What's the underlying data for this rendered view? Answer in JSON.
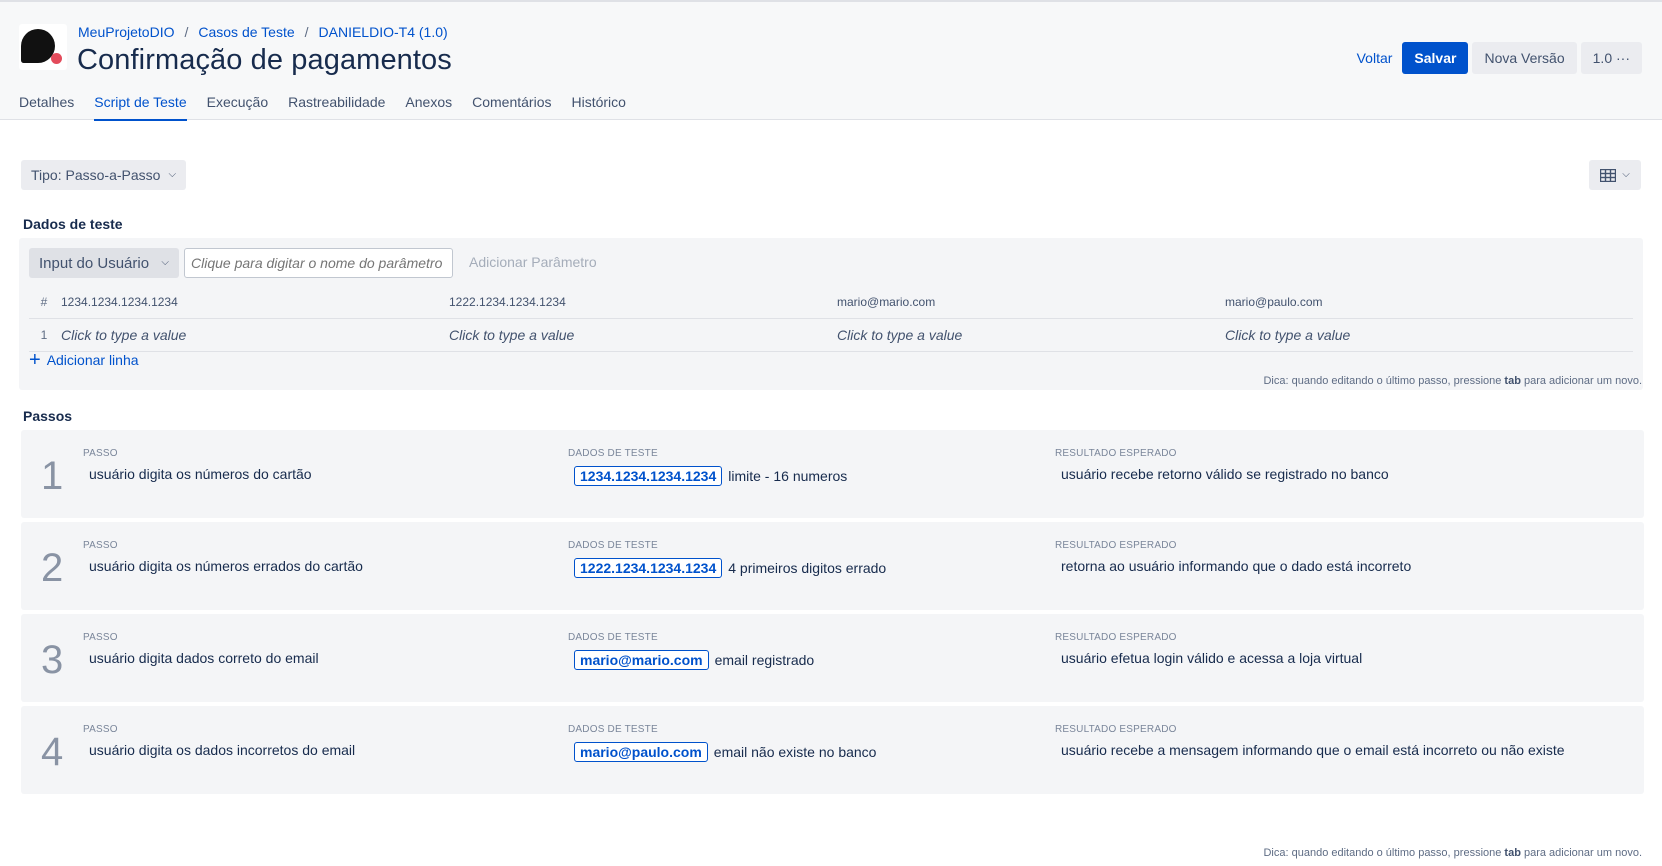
{
  "header": {
    "breadcrumb": [
      "MeuProjetoDIO",
      "Casos de Teste",
      "DANIELDIO-T4 (1.0)"
    ],
    "title": "Confirmação de pagamentos",
    "actions": {
      "back": "Voltar",
      "save": "Salvar",
      "new_version": "Nova Versão",
      "version": "1.0",
      "more": "···"
    }
  },
  "tabs": [
    {
      "label": "Detalhes",
      "active": false
    },
    {
      "label": "Script de Teste",
      "active": true
    },
    {
      "label": "Execução",
      "active": false
    },
    {
      "label": "Rastreabilidade",
      "active": false
    },
    {
      "label": "Anexos",
      "active": false
    },
    {
      "label": "Comentários",
      "active": false
    },
    {
      "label": "Histórico",
      "active": false
    }
  ],
  "toolbar": {
    "type_select": "Tipo: Passo-a-Passo",
    "view_icon": "table-icon"
  },
  "test_data": {
    "title": "Dados de teste",
    "input_type": "Input do Usuário",
    "param_placeholder": "Clique para digitar o nome do parâmetro",
    "add_param": "Adicionar Parâmetro",
    "header_num": "#",
    "columns": [
      "1234.1234.1234.1234",
      "1222.1234.1234.1234",
      "mario@mario.com",
      "mario@paulo.com"
    ],
    "rows": [
      {
        "num": "1",
        "values": [
          "Click to type a value",
          "Click to type a value",
          "Click to type a value",
          "Click to type a value"
        ]
      }
    ],
    "add_line": "Adicionar linha"
  },
  "hint": {
    "prefix": "Dica: quando editando o último passo, pressione",
    "key": "tab",
    "suffix": "para adicionar um novo."
  },
  "steps_section": {
    "title": "Passos",
    "more": "···",
    "labels": {
      "step": "PASSO",
      "data": "DADOS DE TESTE",
      "expected": "RESULTADO ESPERADO"
    },
    "steps": [
      {
        "index": "1",
        "step": "usuário digita os números do cartão",
        "chip": "1234.1234.1234.1234",
        "data": "limite - 16 numeros",
        "expected": "usuário recebe retorno válido se registrado no banco"
      },
      {
        "index": "2",
        "step": "usuário digita os números errados do cartão",
        "chip": "1222.1234.1234.1234",
        "data": "4 primeiros digitos errado",
        "expected": "retorna ao usuário informando que o dado está incorreto"
      },
      {
        "index": "3",
        "step": "usuário digita dados correto do email",
        "chip": "mario@mario.com",
        "data": "email registrado",
        "expected": "usuário efetua login válido e acessa a loja virtual"
      },
      {
        "index": "4",
        "step": "usuário digita os dados incorretos do email",
        "chip": "mario@paulo.com",
        "data": "email não existe no banco",
        "expected": "usuário recebe a mensagem informando que o email está incorreto ou não existe"
      }
    ]
  },
  "colors": {
    "accent": "#0052cc",
    "panel": "#f4f5f7",
    "text": "#172b4d"
  }
}
